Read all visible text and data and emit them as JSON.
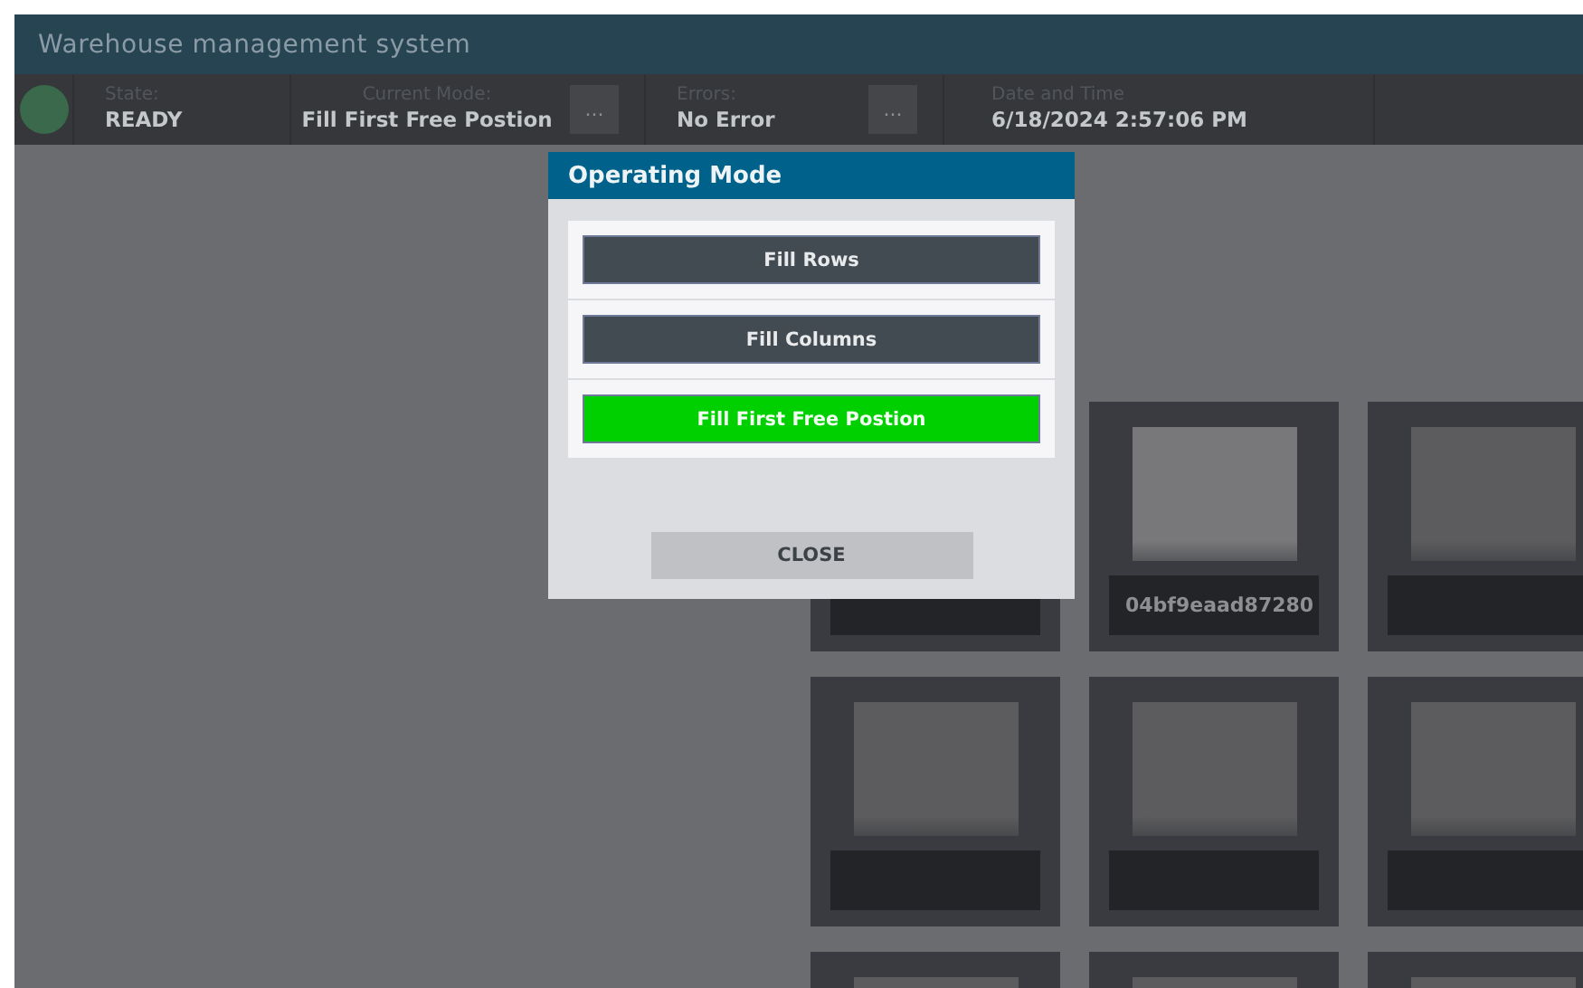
{
  "window": {
    "title": "Warehouse management system"
  },
  "status_bar": {
    "state_ok": true,
    "fields": [
      {
        "kind": "value",
        "label": "State:",
        "value": "READY"
      },
      {
        "kind": "value",
        "label": "Current Mode:",
        "value": "Fill First Free Postion"
      },
      {
        "kind": "more",
        "label": "..."
      },
      {
        "kind": "value",
        "label": "Errors:",
        "value": "No Error"
      },
      {
        "kind": "more",
        "label": "..."
      },
      {
        "kind": "value",
        "label": "Date and Time",
        "value": "6/18/2024 2:57:06 PM"
      },
      {
        "kind": "blank"
      }
    ]
  },
  "dialog": {
    "title": "Operating Mode",
    "modes": [
      {
        "label": "Fill Rows",
        "selected": false
      },
      {
        "label": "Fill Columns",
        "selected": false
      },
      {
        "label": "Fill First Free Postion",
        "selected": true
      }
    ],
    "close": "CLOSE"
  },
  "tiles": [
    {
      "kind": "slot"
    },
    {
      "kind": "slot",
      "occupied": true,
      "label": "04bf9eaad87280"
    },
    {
      "kind": "slot",
      "occupied": false
    },
    {
      "kind": "slot",
      "occupied": false
    },
    {
      "kind": "slot",
      "occupied": false
    },
    {
      "kind": "slot",
      "occupied": false
    },
    {
      "kind": "edge",
      "occupied": false
    },
    {
      "kind": "edge",
      "occupied": false
    },
    {
      "kind": "edge",
      "occupied": false
    }
  ]
}
